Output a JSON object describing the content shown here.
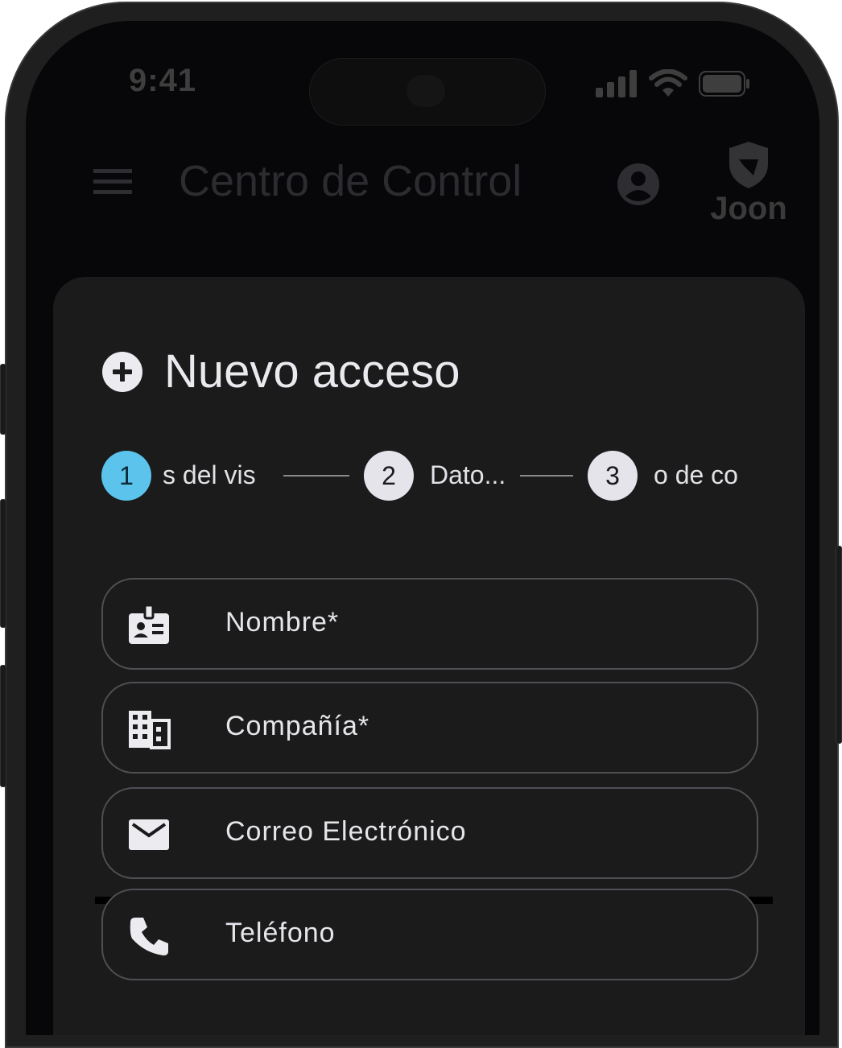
{
  "status_bar": {
    "time": "9:41"
  },
  "app_bar": {
    "title": "Centro de Control",
    "brand": "Joon"
  },
  "sheet": {
    "title": "Nuevo acceso",
    "steps": [
      {
        "number": "1",
        "label": "s del vis",
        "state": "active"
      },
      {
        "number": "2",
        "label": "Dato...",
        "state": "inactive"
      },
      {
        "number": "3",
        "label": "o de co",
        "state": "inactive"
      }
    ],
    "fields": [
      {
        "label": "Nombre*",
        "icon": "contact-card-icon"
      },
      {
        "label": "Compañía*",
        "icon": "building-icon"
      },
      {
        "label": "Correo Electrónico",
        "icon": "mail-icon"
      },
      {
        "label": "Teléfono",
        "icon": "phone-icon"
      }
    ]
  },
  "colors": {
    "active_step": "#5bc3ec",
    "inactive_step": "#e4e4ea",
    "sheet_bg": "#1b1b1c",
    "screen_bg": "#070709"
  }
}
